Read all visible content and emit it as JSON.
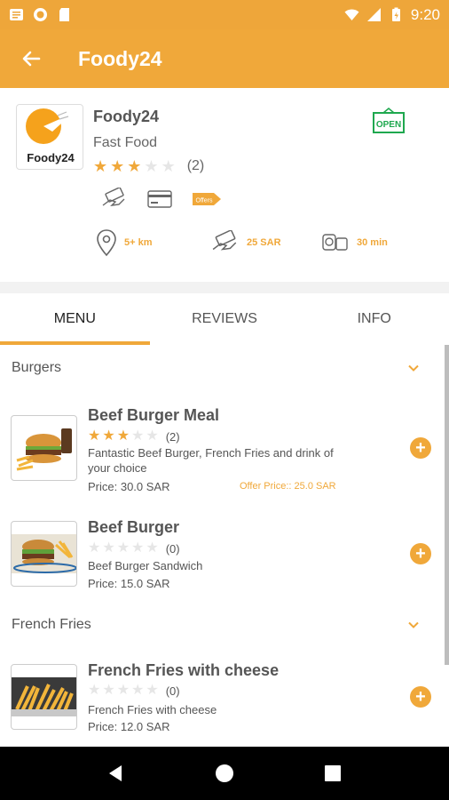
{
  "status_bar": {
    "time": "9:20"
  },
  "app_bar": {
    "title": "Foody24"
  },
  "restaurant": {
    "logo_text": "Foody24",
    "name": "Foody24",
    "category": "Fast Food",
    "rating": 3,
    "rating_count": "(2)",
    "open_badge": "OPEN",
    "offers_tag": "Offers",
    "distance": "5+ km",
    "delivery_fee": "25 SAR",
    "delivery_time": "30 min"
  },
  "tabs": [
    {
      "label": "MENU",
      "active": true
    },
    {
      "label": "REVIEWS",
      "active": false
    },
    {
      "label": "INFO",
      "active": false
    }
  ],
  "sections": [
    {
      "title": "Burgers",
      "items": [
        {
          "name": "Beef Burger Meal",
          "rating": 3,
          "rating_count": "(2)",
          "description": "Fantastic Beef Burger, French Fries and drink of your choice",
          "price": "Price: 30.0 SAR",
          "offer_price": "Offer Price:: 25.0 SAR"
        },
        {
          "name": "Beef Burger",
          "rating": 0,
          "rating_count": "(0)",
          "description": "Beef Burger Sandwich",
          "price": "Price: 15.0 SAR",
          "offer_price": ""
        }
      ]
    },
    {
      "title": "French Fries",
      "items": [
        {
          "name": "French Fries with cheese",
          "rating": 0,
          "rating_count": "(0)",
          "description": "French Fries with cheese",
          "price": "Price: 12.0 SAR",
          "offer_price": ""
        }
      ]
    }
  ],
  "colors": {
    "accent": "#f0a83a",
    "status": "#eea63a",
    "open_green": "#1fa84f"
  }
}
